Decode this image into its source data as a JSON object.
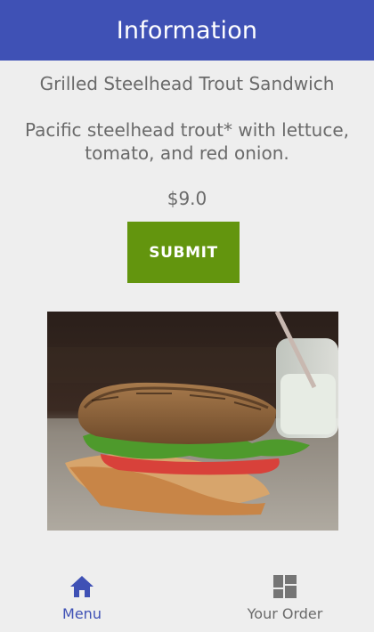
{
  "app_bar": {
    "title": "Information"
  },
  "item": {
    "name": "Grilled Steelhead Trout Sandwich",
    "description": "Pacific steelhead trout* with lettuce, tomato, and red onion.",
    "price": "$9.0"
  },
  "actions": {
    "submit_label": "SUBMIT"
  },
  "image": {
    "subject": "grilled steelhead trout sandwich photo"
  },
  "bottom_nav": {
    "items": [
      {
        "label": "Menu",
        "icon": "home-icon",
        "active": true
      },
      {
        "label": "Your Order",
        "icon": "dashboard-icon",
        "active": false
      }
    ]
  },
  "colors": {
    "primary": "#3f51b5",
    "submit": "#63950e",
    "text": "#6a6a6a",
    "background": "#eeeeee"
  }
}
